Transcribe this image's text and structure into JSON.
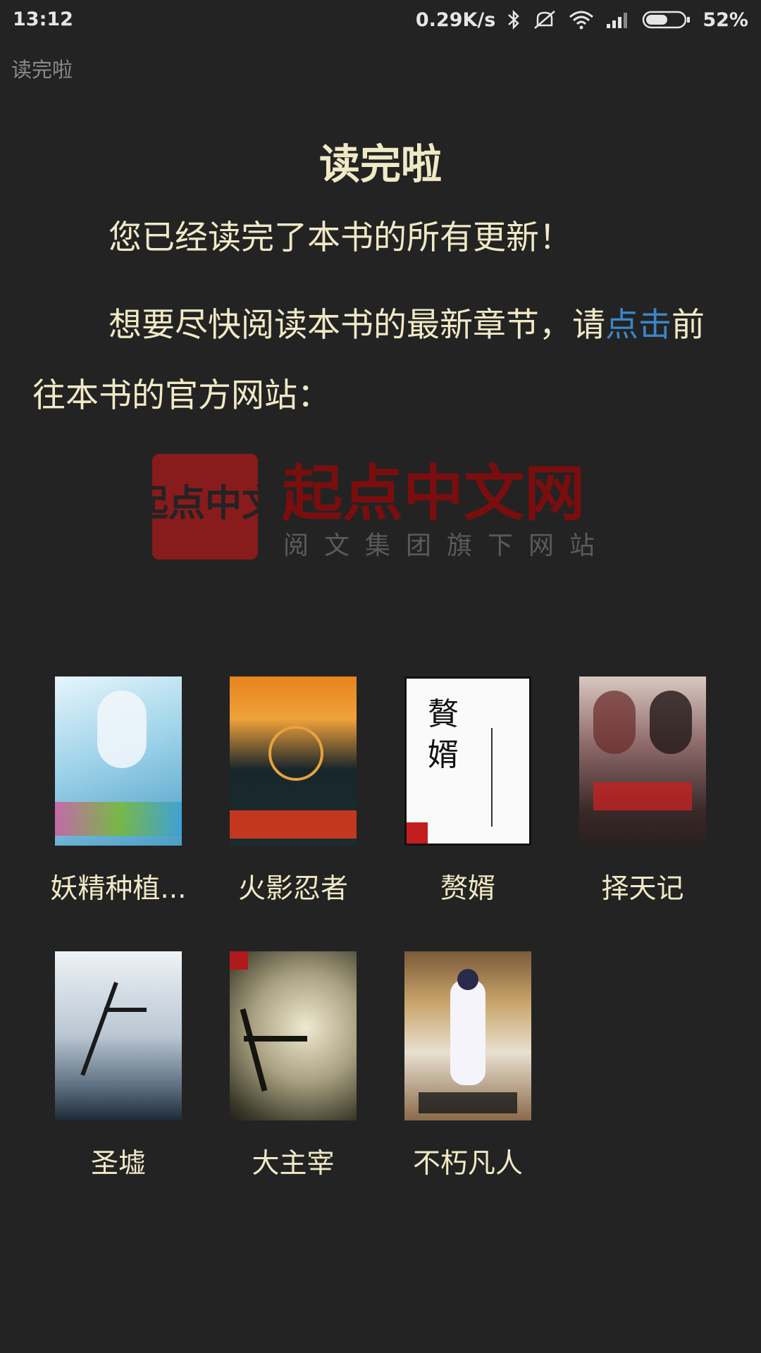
{
  "status_bar": {
    "time": "13:12",
    "speed": "0.29K/s",
    "battery": "52%",
    "icons": [
      "bluetooth-icon",
      "mute-icon",
      "wifi-icon",
      "signal-icon",
      "battery-icon"
    ]
  },
  "header": {
    "title": "读完啦"
  },
  "content": {
    "title": "读完啦",
    "paragraph1": "您已经读完了本书的所有更新！",
    "paragraph2_before": "想要尽快阅读本书的最新章节，请",
    "paragraph2_link": "点击",
    "paragraph2_after": "前往本书的官方网站：",
    "logo": {
      "seal_text": "起点中文",
      "main_text": "起点中文网",
      "sub_text": "阅文集团旗下网站"
    }
  },
  "books": [
    {
      "title": "妖精种植...",
      "cover_colors": [
        "#b8e0f0",
        "#6fb3d9",
        "#e8f4fa"
      ]
    },
    {
      "title": "火影忍者",
      "cover_colors": [
        "#1c2a2a",
        "#e87b1e",
        "#2a9a8a"
      ]
    },
    {
      "title": "赘婿",
      "cover_colors": [
        "#ffffff",
        "#f5f5f5",
        "#222222"
      ]
    },
    {
      "title": "择天记",
      "cover_colors": [
        "#8b6d6d",
        "#3b2c2c",
        "#d0b8a8"
      ]
    },
    {
      "title": "圣墟",
      "cover_colors": [
        "#c8d4de",
        "#8a9aa8",
        "#1e2a36"
      ]
    },
    {
      "title": "大主宰",
      "cover_colors": [
        "#d9d2b8",
        "#6b6a4e",
        "#2a2a20"
      ]
    },
    {
      "title": "不朽凡人",
      "cover_colors": [
        "#c9a46a",
        "#e8e0d0",
        "#6a4a2a"
      ]
    }
  ],
  "colors": {
    "background": "#232323",
    "text": "#f0e9c6",
    "link": "#3a86c8",
    "logo_red": "#8e1010"
  }
}
